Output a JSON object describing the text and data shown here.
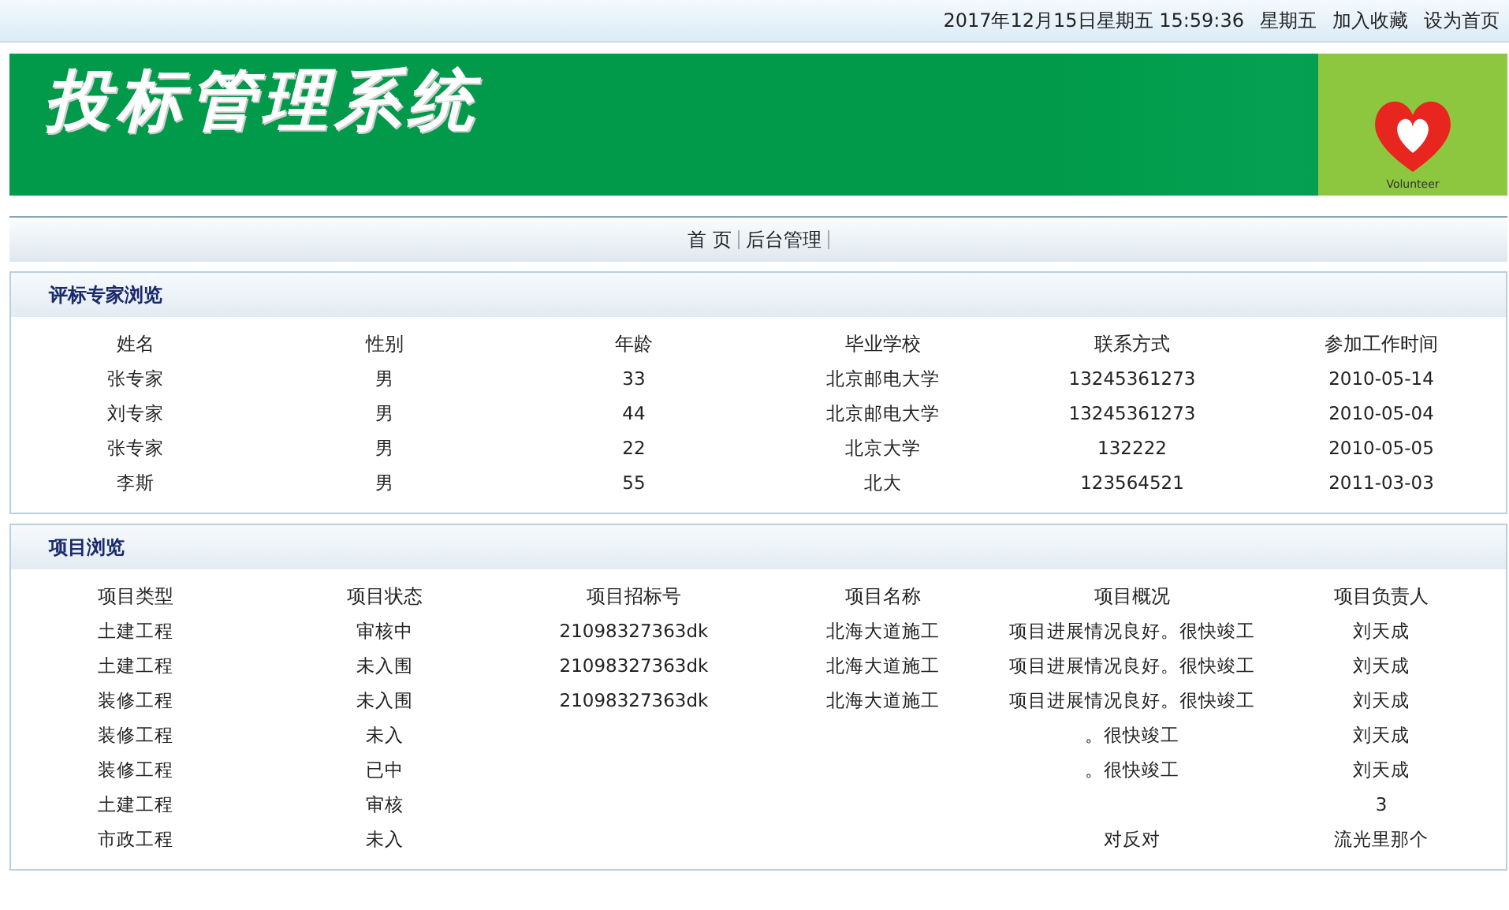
{
  "top_bar": {
    "datetime": "2017年12月15日星期五  15:59:36",
    "weekday": "星期五",
    "links": [
      "加入收藏",
      "设为首页"
    ]
  },
  "header": {
    "title": "投标管理系统",
    "logo_text": "Volunteer"
  },
  "nav": [
    "首 页",
    "后台管理"
  ],
  "panels": [
    {
      "title": "评标专家浏览",
      "columns": [
        "姓名",
        "性别",
        "年龄",
        "毕业学校",
        "联系方式",
        "参加工作时间"
      ],
      "rows": [
        [
          "张专家",
          "男",
          "33",
          "北京邮电大学",
          "13245361273",
          "2010-05-14"
        ],
        [
          "刘专家",
          "男",
          "44",
          "北京邮电大学",
          "13245361273",
          "2010-05-04"
        ],
        [
          "张专家",
          "男",
          "22",
          "北京大学",
          "132222",
          "2010-05-05"
        ],
        [
          "李斯",
          "男",
          "55",
          "北大",
          "123564521",
          "2011-03-03"
        ]
      ]
    },
    {
      "title": "项目浏览",
      "columns": [
        "项目类型",
        "项目状态",
        "项目招标号",
        "项目名称",
        "项目概况",
        "项目负责人"
      ],
      "rows": [
        [
          "土建工程",
          "审核中",
          "21098327363dk",
          "北海大道施工",
          "项目进展情况良好。很快竣工",
          "刘天成"
        ],
        [
          "土建工程",
          "未入围",
          "21098327363dk",
          "北海大道施工",
          "项目进展情况良好。很快竣工",
          "刘天成"
        ],
        [
          "装修工程",
          "未入围",
          "21098327363dk",
          "北海大道施工",
          "项目进展情况良好。很快竣工",
          "刘天成"
        ],
        [
          "装修工程",
          "未入",
          null,
          null,
          "。很快竣工",
          "刘天成"
        ],
        [
          "装修工程",
          "已中",
          null,
          null,
          "。很快竣工",
          "刘天成"
        ],
        [
          "土建工程",
          "审核",
          null,
          null,
          null,
          "3"
        ],
        [
          "市政工程",
          "未入",
          null,
          null,
          "对反对",
          "流光里那个"
        ]
      ]
    }
  ]
}
